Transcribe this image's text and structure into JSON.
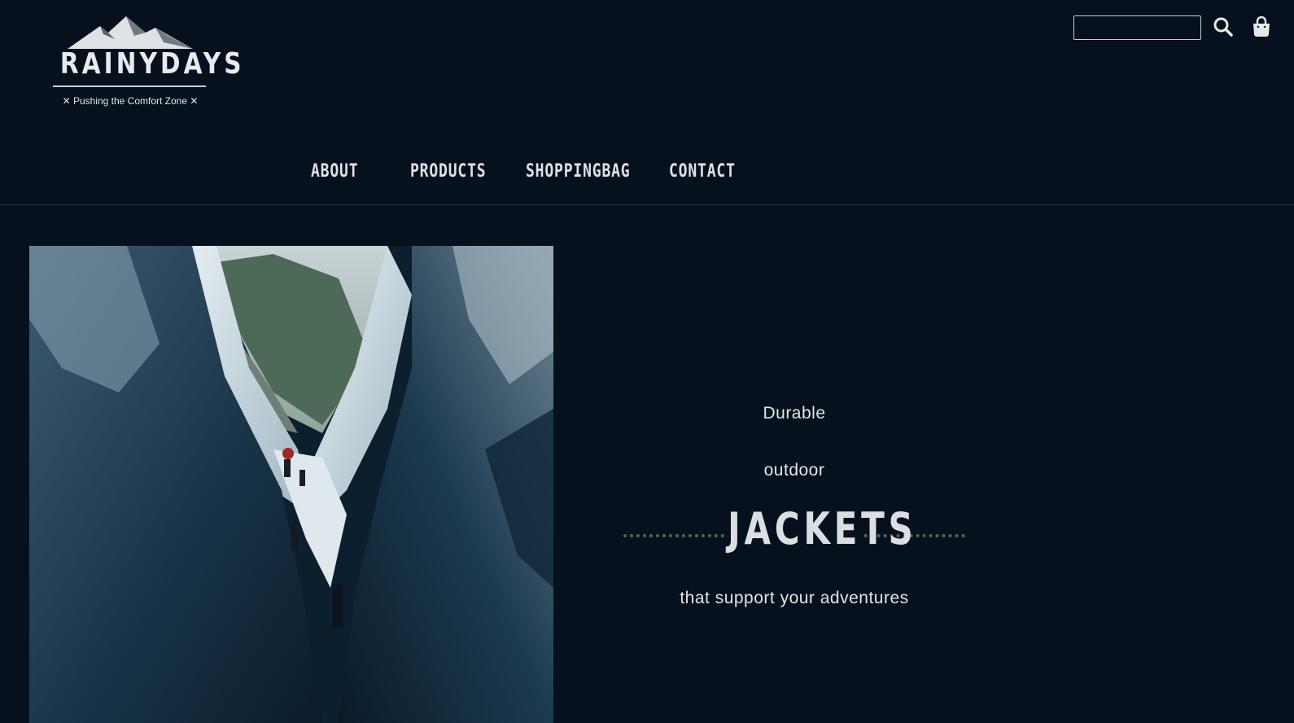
{
  "header": {
    "logo": {
      "brand": "RAINYDAYS",
      "tagline": "✕ Pushing the Comfort Zone ✕"
    },
    "search": {
      "value": "",
      "placeholder": "",
      "icon": "search-icon"
    },
    "cart": {
      "icon": "shopping-bag-icon"
    }
  },
  "nav": {
    "items": [
      {
        "label": "ABOUT"
      },
      {
        "label": "PRODUCTS"
      },
      {
        "label": "SHOPPINGBAG"
      },
      {
        "label": "CONTACT"
      }
    ]
  },
  "hero": {
    "image": "glacier-crevasse-hikers",
    "line1": "Durable",
    "line2": "outdoor",
    "headline": "JACKETS",
    "tagline": "that support your adventures"
  },
  "colors": {
    "background": "#06111d",
    "text": "#e2e5e8",
    "accent_dots": "#4e6a47"
  }
}
